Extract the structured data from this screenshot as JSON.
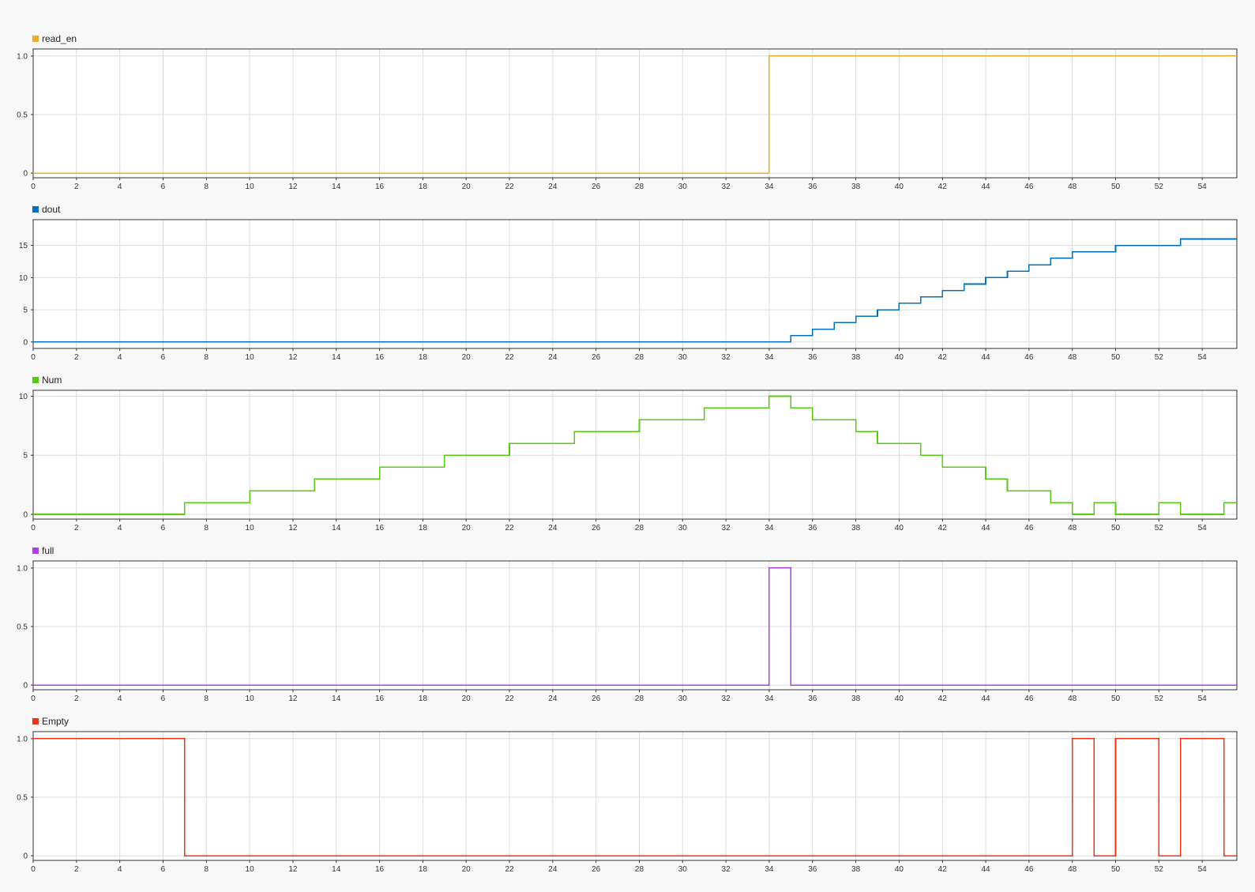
{
  "chart_data": [
    {
      "type": "line",
      "step": true,
      "series": [
        {
          "name": "read_en",
          "color": "#edb120",
          "x": [
            0,
            34,
            55.6
          ],
          "y": [
            0,
            1,
            1
          ]
        }
      ],
      "xlim": [
        0,
        55.6
      ],
      "ylim": [
        -0.04,
        1.06
      ],
      "xticks": [
        0,
        2,
        4,
        6,
        8,
        10,
        12,
        14,
        16,
        18,
        20,
        22,
        24,
        26,
        28,
        30,
        32,
        34,
        36,
        38,
        40,
        42,
        44,
        46,
        48,
        50,
        52,
        54
      ],
      "yticks": [
        0,
        0.5,
        1.0
      ],
      "ytick_labels": [
        "0",
        "0.5",
        "1.0"
      ],
      "grid": true,
      "legend": "top-left"
    },
    {
      "type": "line",
      "step": true,
      "series": [
        {
          "name": "dout",
          "color": "#0072bd",
          "x": [
            0,
            35,
            36,
            37,
            38,
            39,
            40,
            41,
            42,
            43,
            44,
            45,
            46,
            47,
            48,
            50,
            53,
            55.6
          ],
          "y": [
            0,
            1,
            2,
            3,
            4,
            5,
            6,
            7,
            8,
            9,
            10,
            11,
            12,
            13,
            14,
            15,
            16,
            16
          ]
        }
      ],
      "xlim": [
        0,
        55.6
      ],
      "ylim": [
        -1,
        19
      ],
      "xticks": [
        0,
        2,
        4,
        6,
        8,
        10,
        12,
        14,
        16,
        18,
        20,
        22,
        24,
        26,
        28,
        30,
        32,
        34,
        36,
        38,
        40,
        42,
        44,
        46,
        48,
        50,
        52,
        54
      ],
      "yticks": [
        0,
        5,
        10,
        15
      ],
      "ytick_labels": [
        "0",
        "5",
        "10",
        "15"
      ],
      "grid": true,
      "legend": "top-left"
    },
    {
      "type": "line",
      "step": true,
      "series": [
        {
          "name": "Num",
          "color": "#55cc11",
          "x": [
            0,
            7,
            10,
            13,
            16,
            19,
            22,
            25,
            28,
            31,
            34,
            35,
            36,
            38,
            39,
            41,
            42,
            44,
            45,
            47,
            48,
            49,
            50,
            52,
            53,
            55,
            55.6
          ],
          "y": [
            0,
            1,
            2,
            3,
            4,
            5,
            6,
            7,
            8,
            9,
            10,
            9,
            8,
            7,
            6,
            5,
            4,
            3,
            2,
            1,
            0,
            1,
            0,
            1,
            0,
            1,
            1
          ]
        }
      ],
      "xlim": [
        0,
        55.6
      ],
      "ylim": [
        -0.4,
        10.5
      ],
      "xticks": [
        0,
        2,
        4,
        6,
        8,
        10,
        12,
        14,
        16,
        18,
        20,
        22,
        24,
        26,
        28,
        30,
        32,
        34,
        36,
        38,
        40,
        42,
        44,
        46,
        48,
        50,
        52,
        54
      ],
      "yticks": [
        0,
        5,
        10
      ],
      "ytick_labels": [
        "0",
        "5",
        "10"
      ],
      "grid": true,
      "legend": "top-left"
    },
    {
      "type": "line",
      "step": true,
      "series": [
        {
          "name": "full",
          "color": "#b040ee",
          "x": [
            0,
            34,
            35,
            55.6
          ],
          "y": [
            0,
            1,
            0,
            0
          ]
        }
      ],
      "xlim": [
        0,
        55.6
      ],
      "ylim": [
        -0.04,
        1.06
      ],
      "xticks": [
        0,
        2,
        4,
        6,
        8,
        10,
        12,
        14,
        16,
        18,
        20,
        22,
        24,
        26,
        28,
        30,
        32,
        34,
        36,
        38,
        40,
        42,
        44,
        46,
        48,
        50,
        52,
        54
      ],
      "yticks": [
        0,
        0.5,
        1.0
      ],
      "ytick_labels": [
        "0",
        "0.5",
        "1.0"
      ],
      "grid": true,
      "legend": "top-left"
    },
    {
      "type": "line",
      "step": true,
      "series": [
        {
          "name": "Empty",
          "color": "#ee3311",
          "x": [
            0,
            7,
            48,
            49,
            50,
            52,
            53,
            55,
            55.6
          ],
          "y": [
            1,
            0,
            1,
            0,
            1,
            0,
            1,
            0,
            0
          ]
        }
      ],
      "xlim": [
        0,
        55.6
      ],
      "ylim": [
        -0.04,
        1.06
      ],
      "xticks": [
        0,
        2,
        4,
        6,
        8,
        10,
        12,
        14,
        16,
        18,
        20,
        22,
        24,
        26,
        28,
        30,
        32,
        34,
        36,
        38,
        40,
        42,
        44,
        46,
        48,
        50,
        52,
        54
      ],
      "yticks": [
        0,
        0.5,
        1.0
      ],
      "ytick_labels": [
        "0",
        "0.5",
        "1.0"
      ],
      "grid": true,
      "legend": "top-left"
    }
  ]
}
